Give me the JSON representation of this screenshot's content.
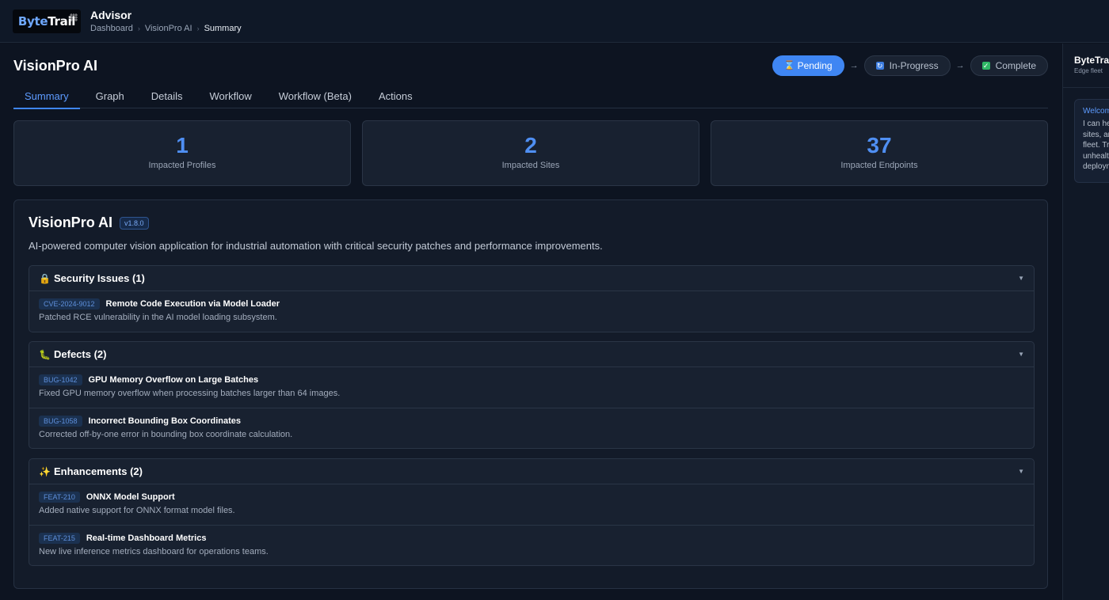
{
  "header": {
    "logo_text_a": "Byte",
    "logo_text_b": "Trail",
    "app_title": "Advisor",
    "breadcrumb": [
      "Dashboard",
      "VisionPro AI",
      "Summary"
    ]
  },
  "page": {
    "title": "VisionPro AI"
  },
  "status_steps": [
    {
      "label": "Pending",
      "active": true,
      "icon": "hourglass-icon"
    },
    {
      "label": "In-Progress",
      "active": false,
      "icon": "progress-icon"
    },
    {
      "label": "Complete",
      "active": false,
      "icon": "check-icon"
    }
  ],
  "tabs": [
    "Summary",
    "Graph",
    "Details",
    "Workflow",
    "Workflow (Beta)",
    "Actions"
  ],
  "active_tab": "Summary",
  "stats": [
    {
      "value": "1",
      "label": "Impacted Profiles"
    },
    {
      "value": "2",
      "label": "Impacted Sites"
    },
    {
      "value": "37",
      "label": "Impacted Endpoints"
    }
  ],
  "release": {
    "title": "VisionPro AI",
    "version": "v1.8.0",
    "description": "AI-powered computer vision application for industrial automation with critical security patches and performance improvements.",
    "sections": [
      {
        "icon": "🔒",
        "icon_name": "lock-icon",
        "title": "Security Issues (1)",
        "items": [
          {
            "id": "CVE-2024-9012",
            "title": "Remote Code Execution via Model Loader",
            "desc": "Patched RCE vulnerability in the AI model loading subsystem."
          }
        ]
      },
      {
        "icon": "🐛",
        "icon_name": "bug-icon",
        "title": "Defects (2)",
        "items": [
          {
            "id": "BUG-1042",
            "title": "GPU Memory Overflow on Large Batches",
            "desc": "Fixed GPU memory overflow when processing batches larger than 64 images."
          },
          {
            "id": "BUG-1058",
            "title": "Incorrect Bounding Box Coordinates",
            "desc": "Corrected off-by-one error in bounding box coordinate calculation."
          }
        ]
      },
      {
        "icon": "✨",
        "icon_name": "sparkles-icon",
        "title": "Enhancements (2)",
        "items": [
          {
            "id": "FEAT-210",
            "title": "ONNX Model Support",
            "desc": "Added native support for ONNX format model files."
          },
          {
            "id": "FEAT-215",
            "title": "Real-time Dashboard Metrics",
            "desc": "New live inference metrics dashboard for operations teams."
          }
        ]
      }
    ]
  },
  "assistant": {
    "title": "ByteTrail",
    "subtitle": "Edge fleet",
    "message_head": "Welcome",
    "message_lines": [
      "I can help",
      "sites, and",
      "fleet. Try",
      "unhealthy",
      "deployments"
    ]
  },
  "colors": {
    "accent": "#3f86f3",
    "stat_value": "#4f8ff3",
    "complete": "#2fb866",
    "background": "#0d1421"
  }
}
